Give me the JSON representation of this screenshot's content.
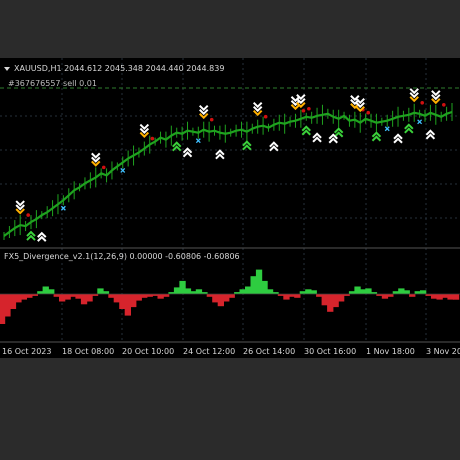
{
  "chart_window": {
    "header": {
      "symbol": "XAUUSD,H1",
      "ohlc": "2044.612 2045.348 2044.440 2044.839",
      "text": "XAUUSD,H1  2044.612 2045.348 2044.440 2044.839"
    },
    "order_label": "#367676557 sell 0.01",
    "indicator_header": "FX5_Divergence_v2.1(12,26,9) 0.00000 -0.60806 -0.60806",
    "time_axis": [
      "16 Oct 2023",
      "18 Oct 08:00",
      "20 Oct 10:00",
      "24 Oct 12:00",
      "26 Oct 14:00",
      "30 Oct 16:00",
      "1 Nov 18:00",
      "3 Nov 20:"
    ]
  },
  "colors": {
    "background": "#000000",
    "grid": "#26303a",
    "price_line": "#1fa31f",
    "order_line": "#2e7d2e",
    "histogram_up": "#2ecc40",
    "histogram_down": "#d6242c",
    "sell_arrow": "#ffb000",
    "buy_arrow": "#3bd23b",
    "signal_arrow": "#ffffff",
    "cross_marker": "#40c0ff",
    "dot_marker": "#d01010"
  },
  "icons": [
    "sell-arrow-icon",
    "buy-arrow-icon",
    "cross-marker-icon",
    "dot-marker-icon"
  ],
  "chart_data": {
    "type": "line",
    "title": "XAUUSD,H1",
    "x": [
      "16 Oct 2023",
      "18 Oct 08:00",
      "20 Oct 10:00",
      "24 Oct 12:00",
      "26 Oct 14:00",
      "30 Oct 16:00",
      "1 Nov 18:00",
      "3 Nov 20:"
    ],
    "series": [
      {
        "name": "XAUUSD,H1",
        "values": [
          1920,
          1924,
          1928,
          1931,
          1930,
          1934,
          1937,
          1941,
          1944,
          1948,
          1952,
          1956,
          1961,
          1966,
          1969,
          1973,
          1976,
          1979,
          1983,
          1981,
          1986,
          1990,
          1994,
          1998,
          2001,
          2004,
          2008,
          2012,
          2015,
          2019,
          2017,
          2021,
          2024,
          2023,
          2026,
          2025,
          2024,
          2027,
          2025,
          2026,
          2024,
          2023,
          2024,
          2026,
          2027,
          2025,
          2028,
          2030,
          2031,
          2029,
          2032,
          2034,
          2033,
          2035,
          2036,
          2038,
          2040,
          2039,
          2041,
          2042,
          2043,
          2040,
          2038,
          2041,
          2036,
          2037,
          2034,
          2038,
          2036,
          2034,
          2035,
          2036,
          2038,
          2040,
          2041,
          2042,
          2044,
          2043,
          2041,
          2044,
          2042,
          2040,
          2043,
          2044.8
        ]
      }
    ],
    "histogram": {
      "name": "FX5_Divergence_v2.1(12,26,9)",
      "values": [
        -3.2,
        -2.4,
        -1.6,
        -0.9,
        -0.6,
        -0.4,
        -0.2,
        0.3,
        0.8,
        0.5,
        -0.3,
        -0.8,
        -0.6,
        -0.3,
        -0.5,
        -1.1,
        -0.8,
        -0.2,
        0.6,
        0.3,
        -0.4,
        -0.9,
        -1.6,
        -2.3,
        -1.4,
        -0.7,
        -0.4,
        -0.3,
        -0.2,
        -0.5,
        -0.3,
        0.2,
        0.7,
        1.4,
        0.6,
        0.3,
        0.5,
        0.2,
        -0.3,
        -0.9,
        -1.3,
        -0.8,
        -0.4,
        0.2,
        0.5,
        0.8,
        1.9,
        2.6,
        1.4,
        0.5,
        0.2,
        -0.2,
        -0.6,
        -0.3,
        -0.4,
        0.3,
        0.5,
        0.4,
        -0.3,
        -1.2,
        -1.9,
        -1.4,
        -0.8,
        -0.2,
        0.3,
        0.8,
        0.5,
        0.6,
        0.2,
        -0.2,
        -0.5,
        -0.3,
        0.3,
        0.6,
        0.4,
        -0.3,
        0.3,
        0.4,
        -0.2,
        -0.5,
        -0.6,
        -0.4,
        -0.6,
        -0.61
      ]
    },
    "signals": {
      "sell": [
        3,
        17,
        26,
        37,
        47,
        54,
        55,
        65,
        66,
        76,
        80
      ],
      "buy": [
        5,
        32,
        45,
        56,
        62,
        69,
        75
      ],
      "white_up": [
        7,
        34,
        40,
        50,
        58,
        61,
        73,
        79
      ]
    },
    "grid": true
  }
}
